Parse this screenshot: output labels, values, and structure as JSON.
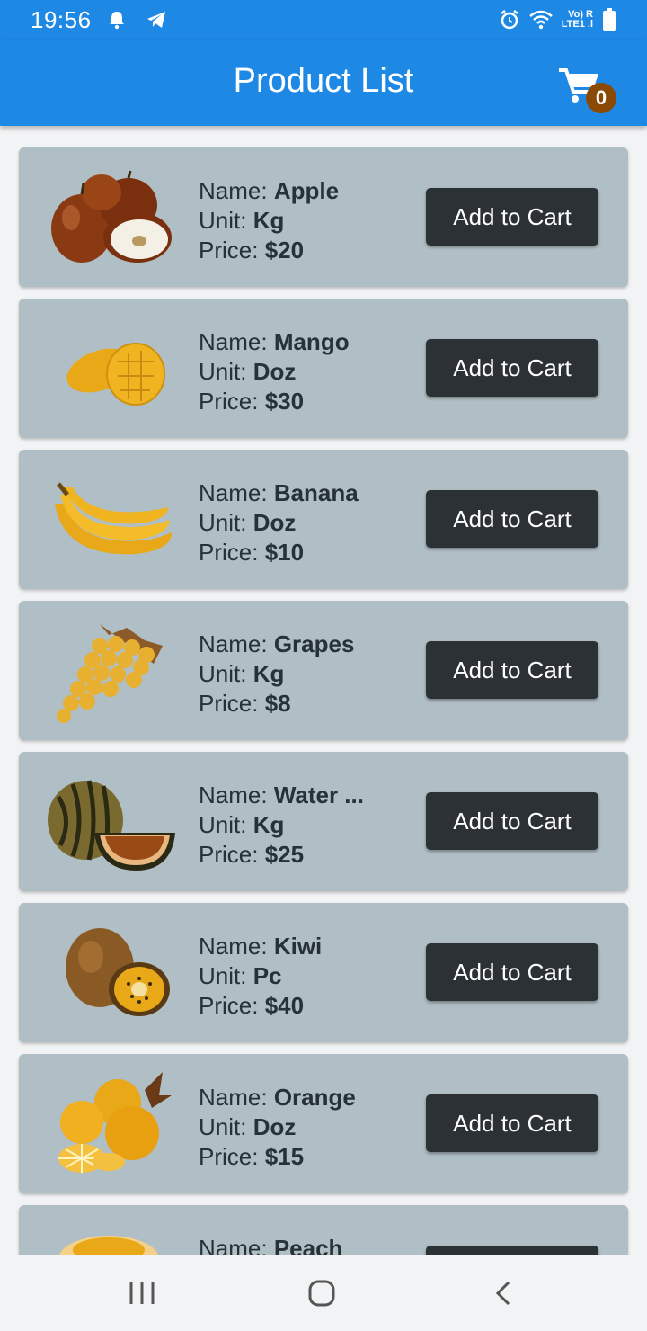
{
  "status_bar": {
    "time": "19:56",
    "network_line1": "Vo) R",
    "network_line2": "LTE1 .l"
  },
  "app_bar": {
    "title": "Product List",
    "cart_count": "0"
  },
  "labels": {
    "name": "Name:",
    "unit": "Unit:",
    "price": "Price:"
  },
  "products": [
    {
      "name": "Apple",
      "unit": "Kg",
      "price": "$20",
      "button": "Add to Cart"
    },
    {
      "name": "Mango",
      "unit": "Doz",
      "price": "$30",
      "button": "Add to Cart"
    },
    {
      "name": "Banana",
      "unit": "Doz",
      "price": "$10",
      "button": "Add to Cart"
    },
    {
      "name": "Grapes",
      "unit": "Kg",
      "price": "$8",
      "button": "Add to Cart"
    },
    {
      "name": "Water ...",
      "unit": "Kg",
      "price": "$25",
      "button": "Add to Cart"
    },
    {
      "name": "Kiwi",
      "unit": "Pc",
      "price": "$40",
      "button": "Add to Cart"
    },
    {
      "name": "Orange",
      "unit": "Doz",
      "price": "$15",
      "button": "Add to Cart"
    },
    {
      "name": "Peach",
      "unit": "",
      "price": "",
      "button": ""
    }
  ],
  "colors": {
    "app_bar": "#1e88e5",
    "card": "#b0bec5",
    "button": "#2c3136",
    "badge": "#8a4a06"
  }
}
